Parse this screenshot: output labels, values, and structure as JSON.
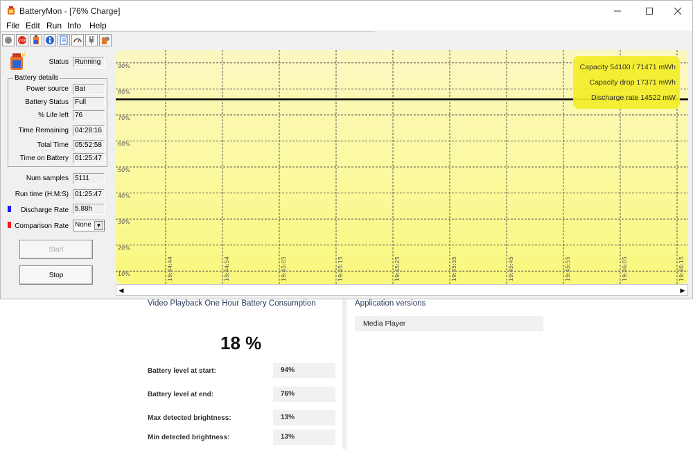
{
  "window": {
    "title": "BatteryMon - [76% Charge]",
    "menu": [
      "File",
      "Edit",
      "Run",
      "Info",
      "Help"
    ]
  },
  "toolbar": {
    "icons": [
      "record-icon",
      "stop-icon",
      "battery-icon",
      "info-icon",
      "notepad-icon",
      "gauge-icon",
      "plug-icon",
      "battery-settings-icon"
    ]
  },
  "status": {
    "label": "Status",
    "value": "Running"
  },
  "battery_details": {
    "group_title": "Battery details",
    "power_source": {
      "label": "Power source",
      "value": "Bat"
    },
    "battery_status": {
      "label": "Battery Status",
      "value": "Full"
    },
    "life_left": {
      "label": "% Life left",
      "value": "76"
    },
    "time_remaining": {
      "label": "Time Remaining",
      "value": "04:28:16"
    },
    "total_time": {
      "label": "Total Time",
      "value": "05:52:58"
    },
    "time_on_battery": {
      "label": "Time on Battery",
      "value": "01:25:47"
    }
  },
  "num_samples": {
    "label": "Num samples",
    "value": "5111"
  },
  "run_time": {
    "label": "Run time (H:M:S)",
    "value": "01:25:47"
  },
  "discharge_rate": {
    "label": "Discharge Rate",
    "value": "5.88h",
    "color": "#1a1aff"
  },
  "comparison_rate": {
    "label": "Comparison Rate",
    "value": "None",
    "color": "#ff1a1a"
  },
  "buttons": {
    "start": "Start",
    "stop": "Stop"
  },
  "graph_info": {
    "capacity": "Capacity 54100 / 71471 mWh",
    "capacity_drop": "Capacity drop 17371 mWh",
    "discharge_rate": "Discharge rate 14522 mW"
  },
  "chart_data": {
    "type": "line",
    "y_tick_labels": [
      "90%",
      "80%",
      "70%",
      "60%",
      "50%",
      "40%",
      "30%",
      "20%",
      "10%"
    ],
    "x_tick_labels": [
      "19:44:44",
      "19:44:54",
      "19:45:05",
      "19:45:15",
      "19:45:25",
      "19:45:35",
      "19:45:45",
      "19:45:55",
      "19:46:05",
      "19:46:15"
    ],
    "ylim": [
      5,
      95
    ],
    "grid": true,
    "series": [
      {
        "color": "#000000",
        "values": [
          76,
          76,
          76,
          76,
          76,
          76,
          76,
          76,
          76,
          76
        ]
      }
    ]
  },
  "report": {
    "title": "Video Playback One Hour Battery Consumption",
    "consumption": "18 %",
    "metrics": [
      {
        "label": "Battery level at start:",
        "value": "94%"
      },
      {
        "label": "Battery level at end:",
        "value": "76%"
      },
      {
        "label": "Max detected brightness:",
        "value": "13%"
      },
      {
        "label": "Min detected brightness:",
        "value": "13%"
      }
    ],
    "app_versions_title": "Application versions",
    "apps": [
      "Media Player"
    ]
  }
}
